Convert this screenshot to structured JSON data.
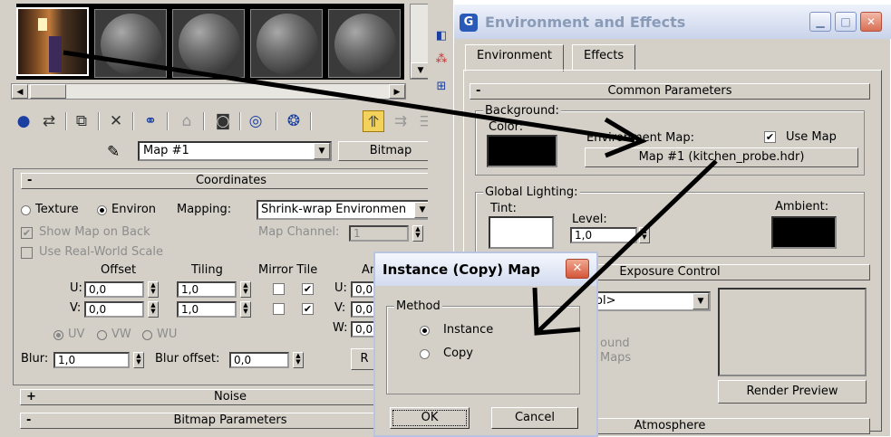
{
  "left_panel": {
    "map_name": "Map #1",
    "map_type": "Bitmap",
    "coordinates": {
      "title": "Coordinates",
      "collapse": "-",
      "texture_label": "Texture",
      "environ_label": "Environ",
      "mapping_label": "Mapping:",
      "mapping_value": "Shrink-wrap Environmen",
      "show_map_on_back": "Show Map on Back",
      "map_channel_label": "Map Channel:",
      "map_channel_value": "1",
      "use_real_world_scale": "Use Real-World Scale",
      "offset_label": "Offset",
      "tiling_label": "Tiling",
      "mirror_tile_label": "Mirror Tile",
      "angle_label_partial": "Ar",
      "u_label": "U:",
      "v_label": "V:",
      "w_label": "W:",
      "u_offset": "0,0",
      "v_offset": "0,0",
      "u_tiling": "1,0",
      "v_tiling": "1,0",
      "u_angle": "0,0",
      "v_angle": "0,0",
      "w_angle": "0,0",
      "uv_label": "UV",
      "vw_label": "VW",
      "wu_label": "WU",
      "blur_label": "Blur:",
      "blur_value": "1,0",
      "blur_offset_label": "Blur offset:",
      "blur_offset_value": "0,0",
      "rotate_partial": "R"
    },
    "noise": {
      "title": "Noise",
      "toggle": "+"
    },
    "bitmap_params": {
      "title": "Bitmap Parameters",
      "toggle": "-"
    }
  },
  "env_window": {
    "title": "Environment and Effects",
    "app_icon_letter": "G",
    "tabs": [
      "Environment",
      "Effects"
    ],
    "common_parameters": {
      "title": "Common Parameters",
      "toggle": "-",
      "background_group": "Background:",
      "color_label": "Color:",
      "environment_map_label": "Environment Map:",
      "use_map_label": "Use Map",
      "map_button": "Map #1 (kitchen_probe.hdr)",
      "background_color": "#000000"
    },
    "global_lighting": {
      "title": "Global Lighting:",
      "tint_label": "Tint:",
      "level_label": "Level:",
      "level_value": "1,0",
      "ambient_label": "Ambient:",
      "tint_color": "#ffffff",
      "ambient_color": "#000000"
    },
    "exposure_control": {
      "title": "Exposure Control",
      "dropdown_partial": "ol>",
      "text1_partial": "ound",
      "text2_partial": "Maps",
      "render_preview": "Render Preview"
    },
    "atmosphere": {
      "title": "Atmosphere"
    }
  },
  "dialog": {
    "title": "Instance (Copy) Map",
    "method_label": "Method",
    "instance_label": "Instance",
    "copy_label": "Copy",
    "ok_label": "OK",
    "cancel_label": "Cancel"
  },
  "colors": {
    "panel_bg": "#d4d0c8",
    "active_tool": "#f2d25a",
    "title_gradient_top": "#eef2fb",
    "close_button": "#d4563a"
  }
}
